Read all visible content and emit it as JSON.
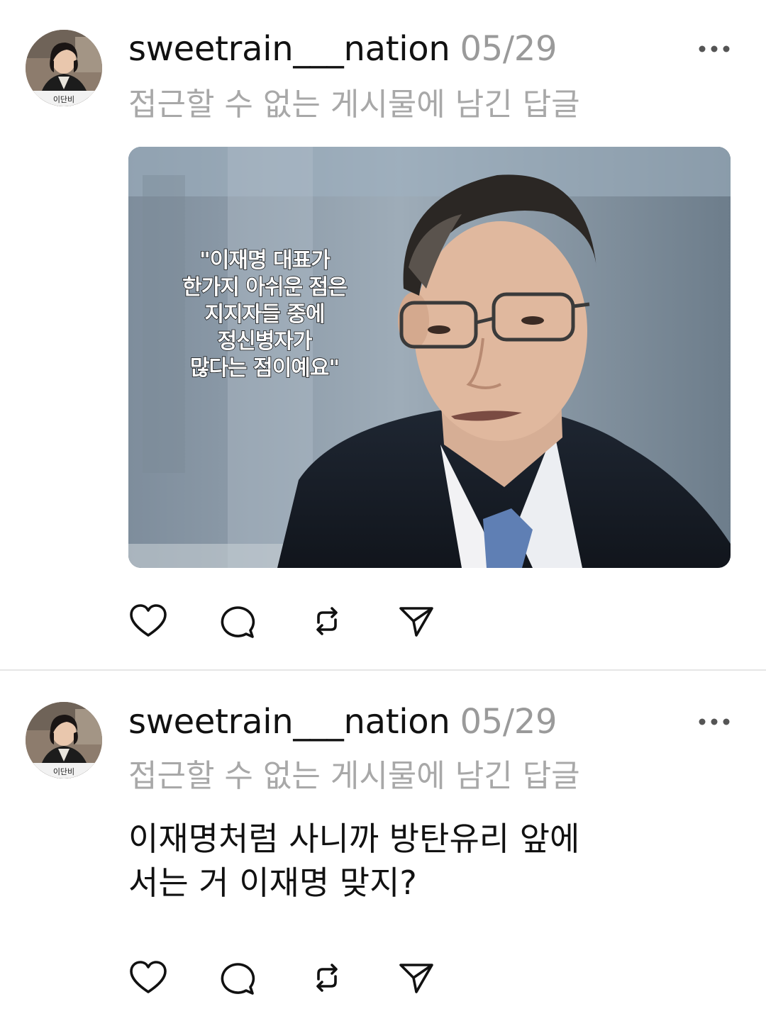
{
  "posts": [
    {
      "username": "sweetrain___nation",
      "date": "05/29",
      "reply_context": "접근할 수 없는 게시물에 남긴 답글",
      "image": {
        "caption": "\"이재명 대표가\n한가지 아쉬운 점은\n지지자들 중에\n정신병자가\n많다는 점이예요\""
      },
      "avatar_badge": "이단비",
      "actions": [
        "heart-icon",
        "comment-icon",
        "repost-icon",
        "share-icon"
      ]
    },
    {
      "username": "sweetrain___nation",
      "date": "05/29",
      "reply_context": "접근할 수 없는 게시물에 남긴 답글",
      "text": "이재명처럼 사니까 방탄유리 앞에\n서는 거 이재명 맞지?",
      "avatar_badge": "이단비",
      "actions": [
        "heart-icon",
        "comment-icon",
        "repost-icon",
        "share-icon"
      ]
    }
  ],
  "colors": {
    "text": "#111111",
    "muted": "#9a9a9a",
    "divider": "#e6e6e6",
    "background": "#ffffff"
  }
}
